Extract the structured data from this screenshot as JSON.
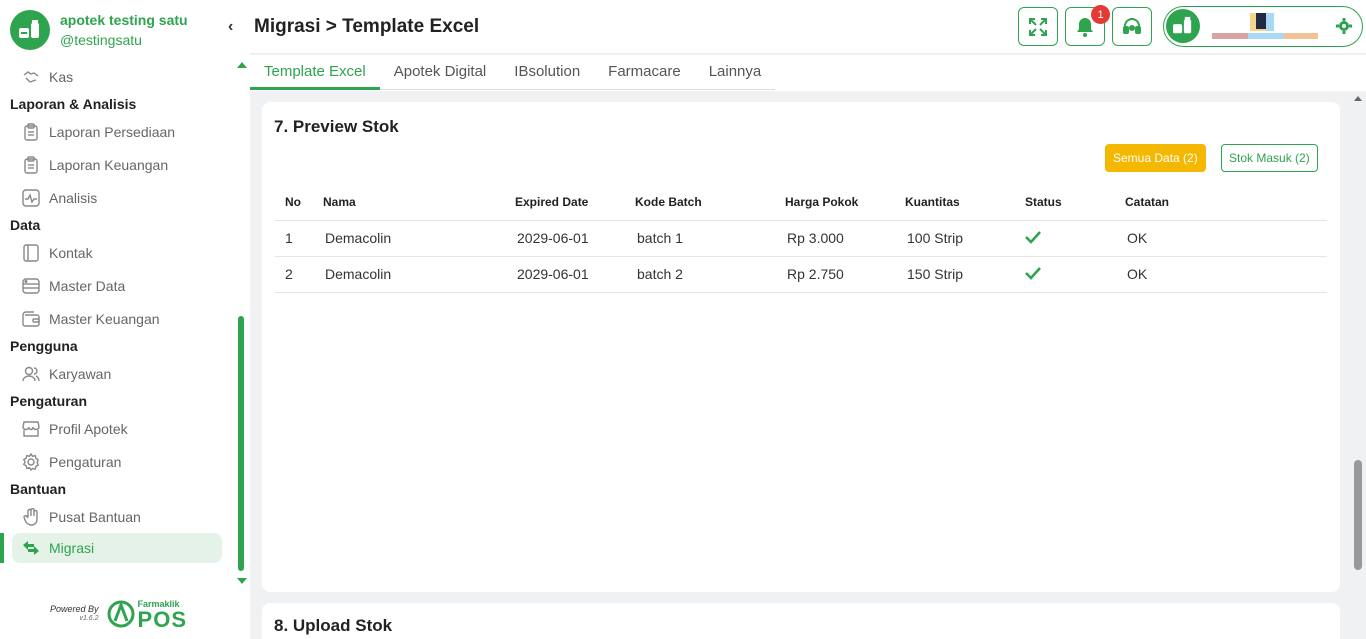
{
  "brand": {
    "name": "apotek testing satu",
    "username": "@testingsatu",
    "collapse_glyph": "‹"
  },
  "sidebar": {
    "items": [
      {
        "type": "item",
        "label": "Kas",
        "icon": "cash-icon"
      },
      {
        "type": "section",
        "label": "Laporan & Analisis"
      },
      {
        "type": "item",
        "label": "Laporan Persediaan",
        "icon": "clipboard-icon"
      },
      {
        "type": "item",
        "label": "Laporan Keuangan",
        "icon": "clipboard-icon"
      },
      {
        "type": "item",
        "label": "Analisis",
        "icon": "pulse-icon"
      },
      {
        "type": "section",
        "label": "Data"
      },
      {
        "type": "item",
        "label": "Kontak",
        "icon": "contact-book-icon"
      },
      {
        "type": "item",
        "label": "Master Data",
        "icon": "database-icon"
      },
      {
        "type": "item",
        "label": "Master Keuangan",
        "icon": "wallet-icon"
      },
      {
        "type": "section",
        "label": "Pengguna"
      },
      {
        "type": "item",
        "label": "Karyawan",
        "icon": "users-icon"
      },
      {
        "type": "section",
        "label": "Pengaturan"
      },
      {
        "type": "item",
        "label": "Profil Apotek",
        "icon": "store-icon"
      },
      {
        "type": "item",
        "label": "Pengaturan",
        "icon": "gear-icon"
      },
      {
        "type": "section",
        "label": "Bantuan"
      },
      {
        "type": "item",
        "label": "Pusat Bantuan",
        "icon": "hand-icon"
      },
      {
        "type": "item",
        "label": "Migrasi",
        "icon": "migrate-icon",
        "active": true
      }
    ]
  },
  "footer": {
    "powered_by": "Powered By",
    "version": "v1.6.2",
    "logo_small": "Farmaklik",
    "logo_big": "POS"
  },
  "header": {
    "title": "Migrasi > Template Excel",
    "notification_count": "1"
  },
  "tabs": [
    "Template Excel",
    "Apotek Digital",
    "IBsolution",
    "Farmacare",
    "Lainnya"
  ],
  "preview": {
    "title": "7. Preview Stok",
    "filter_all": "Semua Data (2)",
    "filter_in": "Stok Masuk (2)",
    "columns": [
      "No",
      "Nama",
      "Expired Date",
      "Kode Batch",
      "Harga Pokok",
      "Kuantitas",
      "Status",
      "Catatan"
    ],
    "rows": [
      [
        "1",
        "Demacolin",
        "2029-06-01",
        "batch 1",
        "Rp 3.000",
        "100 Strip",
        "check",
        "OK"
      ],
      [
        "2",
        "Demacolin",
        "2029-06-01",
        "batch 2",
        "Rp 2.750",
        "150 Strip",
        "check",
        "OK"
      ]
    ]
  },
  "upload": {
    "title": "8. Upload Stok"
  },
  "colors": {
    "accent": "#2ea44f",
    "warning": "#f5b800",
    "badge": "#e53935"
  }
}
